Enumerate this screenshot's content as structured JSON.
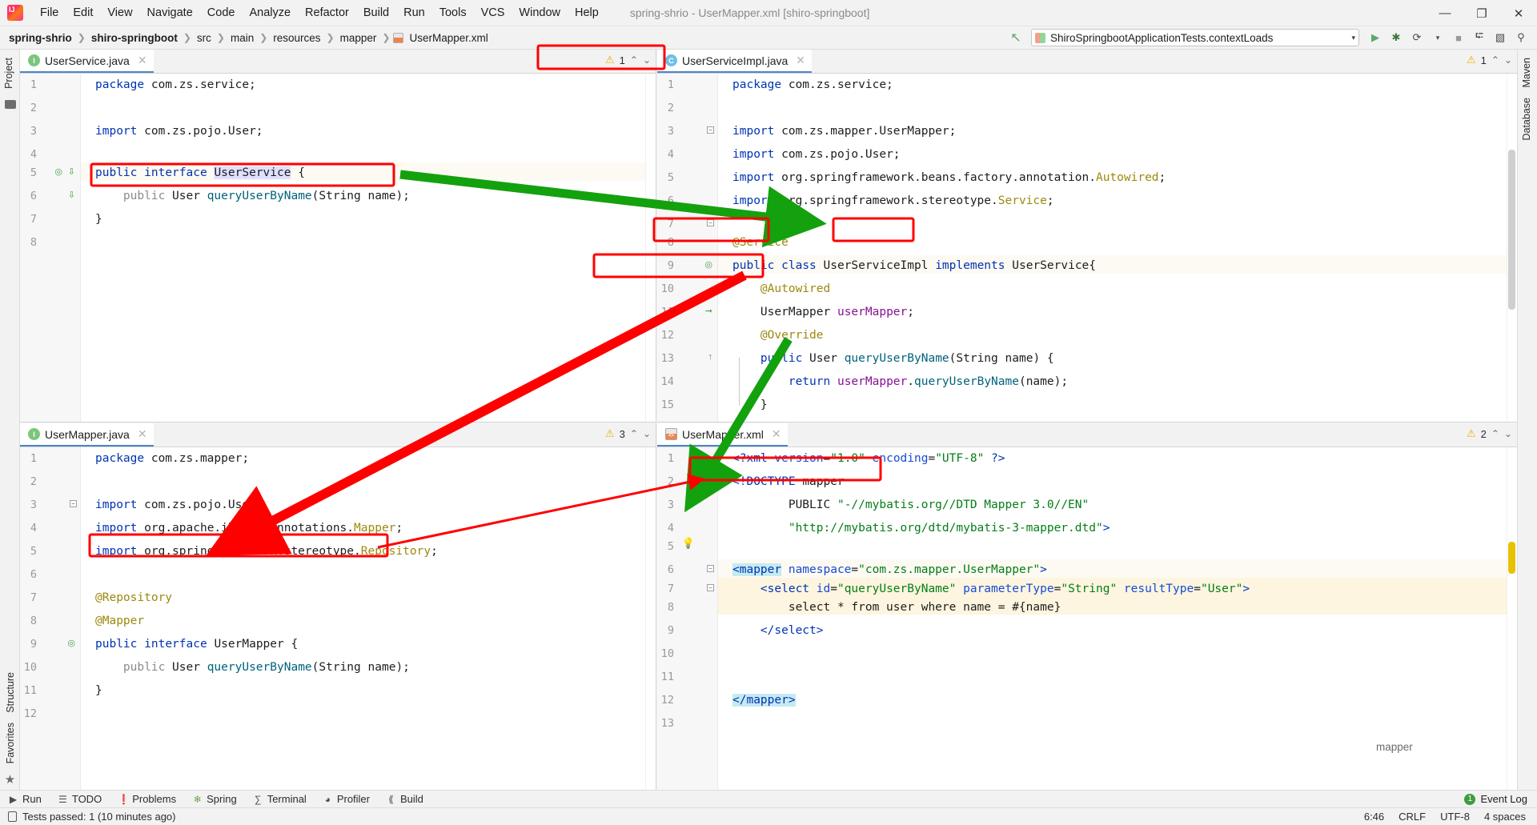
{
  "window": {
    "title": "spring-shrio - UserMapper.xml [shiro-springboot]",
    "minimize": "—",
    "maximize": "❐",
    "close": "✕"
  },
  "menubar": {
    "logo": "jetbrains-intellij-logo",
    "items": [
      "File",
      "Edit",
      "View",
      "Navigate",
      "Code",
      "Analyze",
      "Refactor",
      "Build",
      "Run",
      "Tools",
      "VCS",
      "Window",
      "Help"
    ]
  },
  "breadcrumbs": [
    {
      "label": "spring-shrio",
      "bold": true
    },
    {
      "label": "shiro-springboot",
      "bold": true
    },
    {
      "label": "src",
      "bold": false
    },
    {
      "label": "main",
      "bold": false
    },
    {
      "label": "resources",
      "bold": false
    },
    {
      "label": "mapper",
      "bold": false
    },
    {
      "label": "UserMapper.xml",
      "bold": false,
      "icon": "xml-file-icon"
    }
  ],
  "toolbar": {
    "hammer_label": "↖",
    "run_configuration": "ShiroSpringbootApplicationTests.contextLoads",
    "dropdown_arrow": "▾",
    "run_label": "▶",
    "debug_label": "✱",
    "coverage_label": "⟳",
    "profile_arrow": "▾",
    "stop_label": "■",
    "update_label": "⮓",
    "layout_label": "▧",
    "search_label": "⚲"
  },
  "left_strip": {
    "top_tab": "Project",
    "bottom_tabs": [
      "Structure",
      "Favorites"
    ]
  },
  "right_strip": {
    "tabs": [
      "Maven",
      "Database"
    ]
  },
  "panes": {
    "top_left": {
      "tab": {
        "label": "UserService.java",
        "icon": "interface-icon",
        "close": "✕"
      },
      "inspections": {
        "count": "1",
        "warn_icon": "warning-triangle-icon",
        "up": "⌃",
        "down": "⌄"
      },
      "lines": [
        {
          "n": "1",
          "text": "package com.zs.service;"
        },
        {
          "n": "2",
          "text": ""
        },
        {
          "n": "3",
          "text": "import com.zs.pojo.User;"
        },
        {
          "n": "4",
          "text": ""
        },
        {
          "n": "5",
          "text": "public interface UserService {"
        },
        {
          "n": "6",
          "text": "    public User queryUserByName(String name);"
        },
        {
          "n": "7",
          "text": "}"
        },
        {
          "n": "8",
          "text": ""
        }
      ]
    },
    "top_right": {
      "tab": {
        "label": "UserServiceImpl.java",
        "icon": "class-icon",
        "close": "✕"
      },
      "inspections": {
        "count": "1",
        "warn_icon": "warning-triangle-icon",
        "up": "⌃",
        "down": "⌄"
      },
      "lines": [
        {
          "n": "1",
          "text": "package com.zs.service;"
        },
        {
          "n": "2",
          "text": ""
        },
        {
          "n": "3",
          "text": "import com.zs.mapper.UserMapper;"
        },
        {
          "n": "4",
          "text": "import com.zs.pojo.User;"
        },
        {
          "n": "5",
          "text": "import org.springframework.beans.factory.annotation.Autowired;"
        },
        {
          "n": "6",
          "text": "import org.springframework.stereotype.Service;"
        },
        {
          "n": "7",
          "text": ""
        },
        {
          "n": "8",
          "text": "@Service"
        },
        {
          "n": "9",
          "text": "public class UserServiceImpl implements UserService{"
        },
        {
          "n": "10",
          "text": "    @Autowired"
        },
        {
          "n": "11",
          "text": "    UserMapper userMapper;"
        },
        {
          "n": "12",
          "text": "    @Override"
        },
        {
          "n": "13",
          "text": "    public User queryUserByName(String name) {"
        },
        {
          "n": "14",
          "text": "        return userMapper.queryUserByName(name);"
        },
        {
          "n": "15",
          "text": "    }"
        }
      ]
    },
    "bottom_left": {
      "tab": {
        "label": "UserMapper.java",
        "icon": "interface-icon",
        "close": "✕"
      },
      "inspections": {
        "count": "3",
        "warn_icon": "warning-triangle-icon",
        "up": "⌃",
        "down": "⌄"
      },
      "lines": [
        {
          "n": "1",
          "text": "package com.zs.mapper;"
        },
        {
          "n": "2",
          "text": ""
        },
        {
          "n": "3",
          "text": "import com.zs.pojo.User;"
        },
        {
          "n": "4",
          "text": "import org.apache.ibatis.annotations.Mapper;"
        },
        {
          "n": "5",
          "text": "import org.springframework.stereotype.Repository;"
        },
        {
          "n": "6",
          "text": ""
        },
        {
          "n": "7",
          "text": "@Repository"
        },
        {
          "n": "8",
          "text": "@Mapper"
        },
        {
          "n": "9",
          "text": "public interface UserMapper {"
        },
        {
          "n": "10",
          "text": "    public User queryUserByName(String name);"
        },
        {
          "n": "11",
          "text": "}"
        },
        {
          "n": "12",
          "text": ""
        }
      ]
    },
    "bottom_right": {
      "tab": {
        "label": "UserMapper.xml",
        "icon": "xml-file-icon",
        "close": "✕"
      },
      "inspections": {
        "count": "2",
        "warn_icon": "warning-triangle-icon",
        "up": "⌃",
        "down": "⌄"
      },
      "lines": [
        {
          "n": "1",
          "text": "<?xml version=\"1.0\" encoding=\"UTF-8\" ?>"
        },
        {
          "n": "2",
          "text": "<!DOCTYPE mapper"
        },
        {
          "n": "3",
          "text": "        PUBLIC \"-//mybatis.org//DTD Mapper 3.0//EN\""
        },
        {
          "n": "4",
          "text": "        \"http://mybatis.org/dtd/mybatis-3-mapper.dtd\">"
        },
        {
          "n": "5",
          "text": ""
        },
        {
          "n": "6",
          "text": "<mapper namespace=\"com.zs.mapper.UserMapper\">"
        },
        {
          "n": "7",
          "text": "    <select id=\"queryUserByName\" parameterType=\"String\" resultType=\"User\">"
        },
        {
          "n": "8",
          "text": "        select * from user where name = #{name}"
        },
        {
          "n": "9",
          "text": "    </select>"
        },
        {
          "n": "10",
          "text": ""
        },
        {
          "n": "11",
          "text": ""
        },
        {
          "n": "12",
          "text": "</mapper>"
        },
        {
          "n": "13",
          "text": ""
        }
      ],
      "breadcrumb": "mapper"
    }
  },
  "annotations": {
    "red_boxes": [
      "UserServiceImpl.java tab",
      "UserService.java line 6 method signature",
      "UserServiceImpl class name",
      "UserService interface reference",
      "UserMapper userMapper field",
      "UserMapper.java line 10 method signature",
      "namespace com.zs.mapper.UserMapper"
    ],
    "green_arrows": 2,
    "red_arrows": 2
  },
  "tool_window_bar": {
    "items": [
      {
        "label": "Run",
        "icon": "play-icon"
      },
      {
        "label": "TODO",
        "icon": "list-icon"
      },
      {
        "label": "Problems",
        "icon": "exclamation-circle-icon"
      },
      {
        "label": "Spring",
        "icon": "leaf-icon"
      },
      {
        "label": "Terminal",
        "icon": "terminal-icon"
      },
      {
        "label": "Profiler",
        "icon": "gauge-icon"
      },
      {
        "label": "Build",
        "icon": "hammer-icon"
      }
    ],
    "event_log": {
      "label": "Event Log",
      "count": "1",
      "icon": "event-log-icon"
    }
  },
  "statusbar": {
    "message": "Tests passed: 1 (10 minutes ago)",
    "message_icon": "test-status-icon",
    "caret": "6:46",
    "line_separator": "CRLF",
    "encoding": "UTF-8",
    "indent": "4 spaces"
  }
}
